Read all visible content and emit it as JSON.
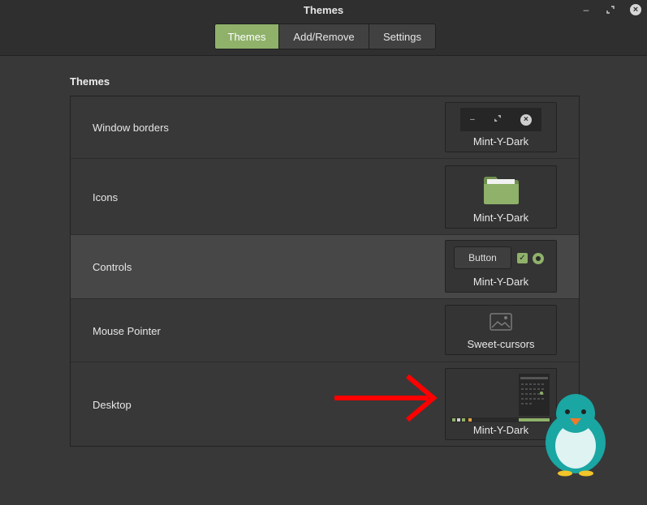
{
  "window": {
    "title": "Themes",
    "controls": [
      "minimize-icon",
      "maximize-icon",
      "close-icon"
    ]
  },
  "tabs": [
    {
      "label": "Themes",
      "active": true
    },
    {
      "label": "Add/Remove",
      "active": false
    },
    {
      "label": "Settings",
      "active": false
    }
  ],
  "section": {
    "title": "Themes"
  },
  "rows": [
    {
      "label": "Window borders",
      "value": "Mint-Y-Dark"
    },
    {
      "label": "Icons",
      "value": "Mint-Y-Dark"
    },
    {
      "label": "Controls",
      "value": "Mint-Y-Dark",
      "button_label": "Button"
    },
    {
      "label": "Mouse Pointer",
      "value": "Sweet-cursors"
    },
    {
      "label": "Desktop",
      "value": "Mint-Y-Dark"
    }
  ],
  "colors": {
    "accent": "#8fb16a",
    "background": "#383838",
    "annotation_arrow": "#ff0000"
  }
}
